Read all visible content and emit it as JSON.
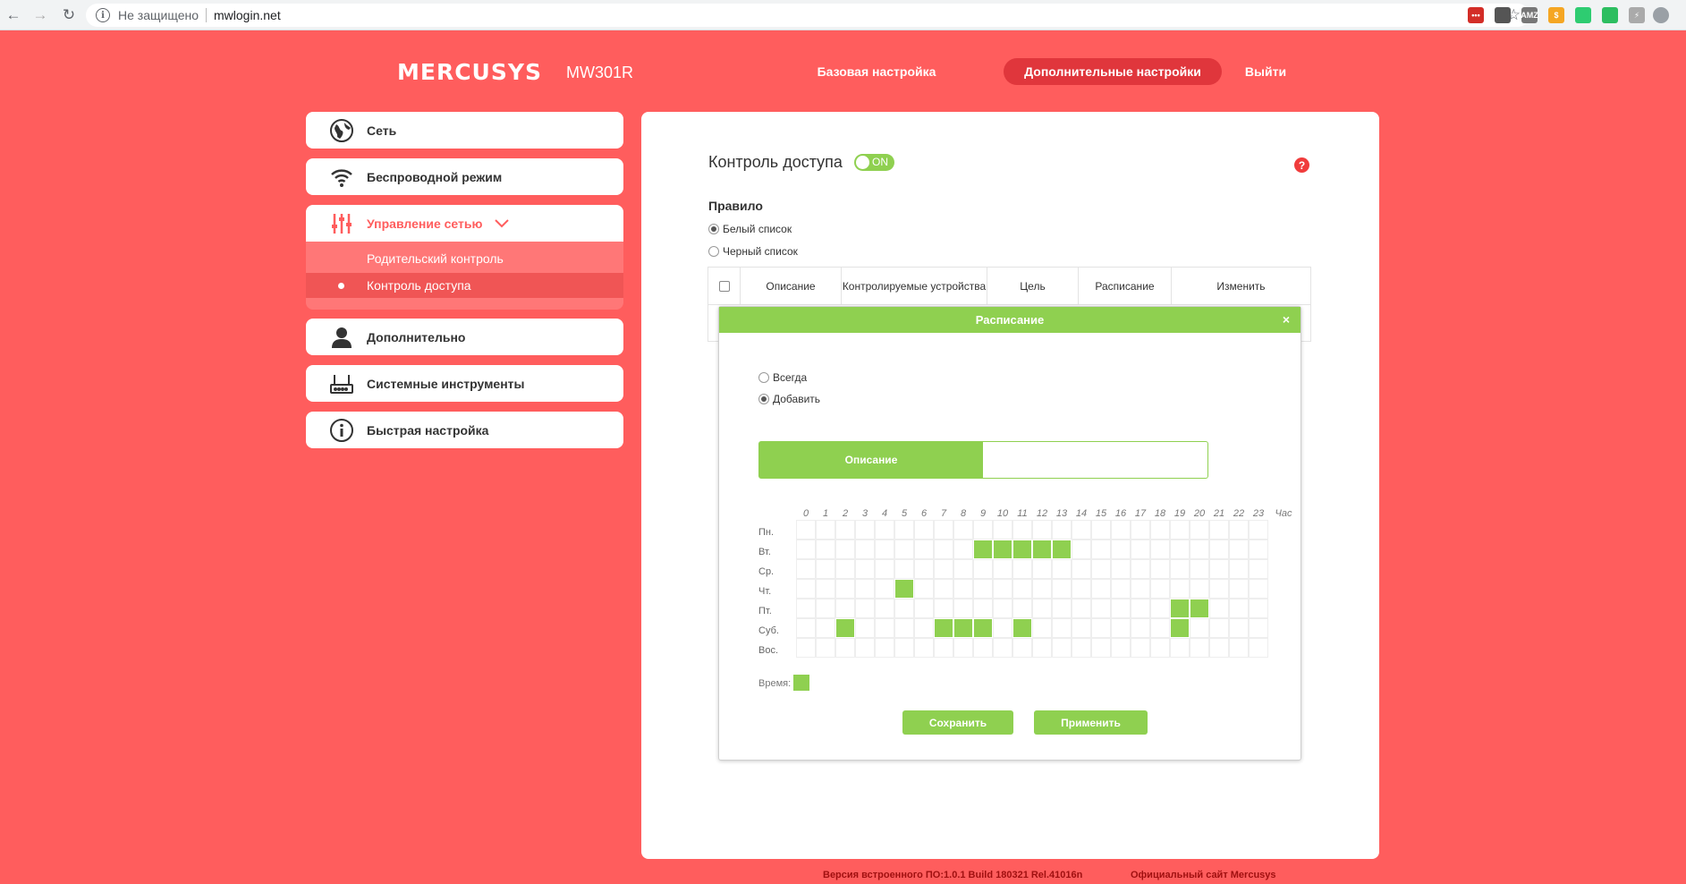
{
  "browser": {
    "security_label": "Не защищено",
    "url": "mwlogin.net",
    "extensions": [
      {
        "name": "lastpass-extension-icon",
        "label": "•••",
        "color": "#d32d27"
      },
      {
        "name": "pocket-extension-icon",
        "label": "",
        "color": "#555555"
      },
      {
        "name": "amazon-extension-icon",
        "label": "AMZ",
        "color": "#777777"
      },
      {
        "name": "coupon-extension-icon",
        "label": "$",
        "color": "#f5a623"
      },
      {
        "name": "tag-extension-icon",
        "label": "",
        "color": "#2ecc71"
      },
      {
        "name": "evernote-extension-icon",
        "label": "",
        "color": "#2dbe60"
      },
      {
        "name": "bolt-extension-icon",
        "label": "⚡",
        "color": "#aaaaaa"
      }
    ]
  },
  "header": {
    "brand": "MERCUSYS",
    "model": "MW301R",
    "nav": {
      "basic": "Базовая настройка",
      "advanced": "Дополнительные настройки",
      "logout": "Выйти"
    }
  },
  "sidebar": {
    "items": [
      {
        "label": "Сеть",
        "icon": "globe-icon"
      },
      {
        "label": "Беспроводной режим",
        "icon": "wifi-icon"
      },
      {
        "label": "Управление сетью",
        "icon": "sliders-icon"
      },
      {
        "label": "Дополнительно",
        "icon": "user-icon"
      },
      {
        "label": "Системные инструменты",
        "icon": "router-icon"
      },
      {
        "label": "Быстрая настройка",
        "icon": "info-icon"
      }
    ],
    "subitems": [
      {
        "label": "Родительский контроль"
      },
      {
        "label": "Контроль доступа"
      }
    ]
  },
  "content": {
    "title": "Контроль доступа",
    "toggle_label": "ON",
    "help": "?",
    "rule_label": "Правило",
    "rules": [
      "Белый список",
      "Черный список"
    ],
    "table_headers": [
      "Описание",
      "Контролируемые устройства",
      "Цель",
      "Расписание",
      "Изменить"
    ]
  },
  "modal": {
    "title": "Расписание",
    "close": "×",
    "options": [
      "Всегда",
      "Добавить"
    ],
    "desc_label": "Описание",
    "desc_value": "",
    "hours": [
      "0",
      "1",
      "2",
      "3",
      "4",
      "5",
      "6",
      "7",
      "8",
      "9",
      "10",
      "11",
      "12",
      "13",
      "14",
      "15",
      "16",
      "17",
      "18",
      "19",
      "20",
      "21",
      "22",
      "23"
    ],
    "hour_unit": "Час",
    "days": [
      "Пн.",
      "Вт.",
      "Ср.",
      "Чт.",
      "Пт.",
      "Суб.",
      "Вос."
    ],
    "schedule": {
      "Вт.": [
        9,
        10,
        11,
        12,
        13
      ],
      "Чт.": [
        5
      ],
      "Пт.": [
        19,
        20
      ],
      "Суб.": [
        2,
        7,
        8,
        9,
        11,
        19
      ]
    },
    "legend_label": "Время:",
    "save": "Сохранить",
    "apply": "Применить"
  },
  "footer": {
    "firmware": "Версия встроенного ПО:1.0.1 Build 180321 Rel.41016n",
    "site": "Официальный сайт Mercusys"
  }
}
